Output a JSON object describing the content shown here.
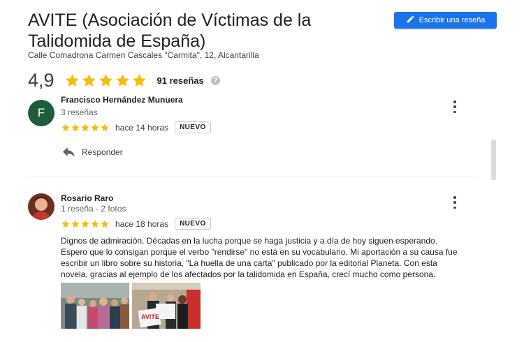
{
  "place": {
    "title": "AVITE (Asociación de Víctimas de la Talidomida de España)",
    "address": "Calle Comadrona Carmen Cascales \"Carmita\", 12, Alcantarilla"
  },
  "write_review_button": {
    "label": "Escribir una reseña",
    "icon": "pencil-icon"
  },
  "summary": {
    "rating": "4,9",
    "stars": 5,
    "count_label": "91 reseñas",
    "help_icon": "?"
  },
  "reviews": [
    {
      "author": "Francisco Hernández Munuera",
      "avatar_letter": "F",
      "meta": "3 reseñas",
      "stars": 5,
      "time": "hace 14 horas",
      "badge": "NUEVO",
      "reply_label": "Responder"
    },
    {
      "author": "Rosario Raro",
      "meta": "1 reseña · 2 fotos",
      "stars": 5,
      "time": "hace 18 horas",
      "badge": "NUEVO",
      "text": "Dignos de admiración. Décadas en la lucha porque se haga justicia y a día de hoy siguen esperando. Espero que lo consigan porque el verbo \"rendirse\" no está en su vocabulario. Mi aportación a su causa fue escribir un libro sobre su historia, \"La huella de una carta\" publicado por la editorial Planeta. Con esta novela, gracias al ejemplo de los afectados por la talidomida en España, crecí mucho como persona.",
      "photos": [
        {
          "kind": "group-photo"
        },
        {
          "kind": "award-photo",
          "banner_text": "AVITE"
        }
      ]
    }
  ],
  "colors": {
    "accent": "#1a73e8",
    "star": "#fbbc04",
    "avatar_green": "#1e5b3b"
  }
}
